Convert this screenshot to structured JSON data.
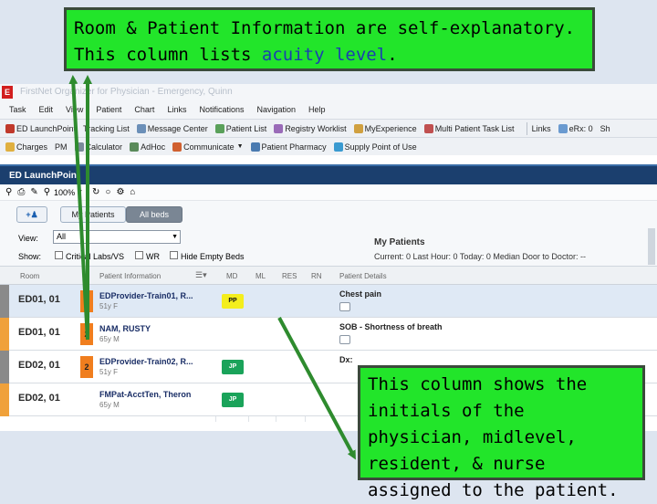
{
  "callout_top": {
    "line1_pre": "Room & Patient Information are self-explanatory.",
    "line2_pre": "This column lists ",
    "line2_hl": "acuity level",
    "line2_post": "."
  },
  "callout_bottom": {
    "text": "This column shows the initials of the physician, midlevel, resident, & nurse assigned to the patient."
  },
  "app": {
    "title": "FirstNet Organizer for Physician - Emergency, Quinn",
    "logo": "E",
    "menu": [
      "Task",
      "Edit",
      "View",
      "Patient",
      "Chart",
      "Links",
      "Notifications",
      "Navigation",
      "Help"
    ],
    "toolbar1": [
      "ED LaunchPoint",
      "Tracking List",
      "Message Center",
      "Patient List",
      "Registry Worklist",
      "MyExperience",
      "Multi Patient Task List",
      "Links",
      "eRx: 0",
      "Sh"
    ],
    "toolbar2": [
      "Charges",
      "PM",
      "Calculator",
      "AdHoc",
      "Communicate",
      "Patient Pharmacy",
      "Supply Point of Use"
    ],
    "launch_title": "ED LaunchPoint",
    "zoom": "100%",
    "tabs": {
      "my_patients": "My Patients",
      "all_beds": "All beds"
    },
    "view_label": "View:",
    "view_value": "All",
    "show_label": "Show:",
    "show_options": [
      "Critical Labs/VS",
      "WR",
      "Hide Empty Beds"
    ],
    "my_patients_title": "My Patients",
    "stats": "Current: 0   Last Hour: 0   Today: 0   Median Door to Doctor: --",
    "columns": {
      "room": "Room",
      "patient_info": "Patient Information",
      "md": "MD",
      "ml": "ML",
      "res": "RES",
      "rn": "RN",
      "details": "Patient Details"
    },
    "rows": [
      {
        "room": "ED01, 01",
        "acuity": "2",
        "name": "EDProvider-Train01, R...",
        "info": "51y F",
        "md": "PP",
        "detail": "Chest pain",
        "strip": "#8a8a8a",
        "md_bg": "#f4ee1c",
        "md_fg": "#111"
      },
      {
        "room": "ED01, 01",
        "acuity": "2",
        "name": "NAM, RUSTY",
        "info": "65y M",
        "md": "",
        "detail": "SOB - Shortness of breath",
        "strip": "#f0a13a",
        "md_bg": "",
        "md_fg": ""
      },
      {
        "room": "ED02, 01",
        "acuity": "2",
        "name": "EDProvider-Train02, R...",
        "info": "51y F",
        "md": "JP",
        "detail": "Dx:",
        "strip": "#8a8a8a",
        "md_bg": "#1aa35a",
        "md_fg": "#fff"
      },
      {
        "room": "ED02, 01",
        "acuity": "",
        "name": "FMPat-AcctTen, Theron",
        "info": "65y M",
        "md": "JP",
        "detail": "",
        "strip": "#f0a13a",
        "md_bg": "#1aa35a",
        "md_fg": "#fff"
      }
    ],
    "colors": {
      "acuity_orange": "#f07e1e",
      "header_blue": "#1b3f6e",
      "callout_green": "#22e52a"
    }
  }
}
